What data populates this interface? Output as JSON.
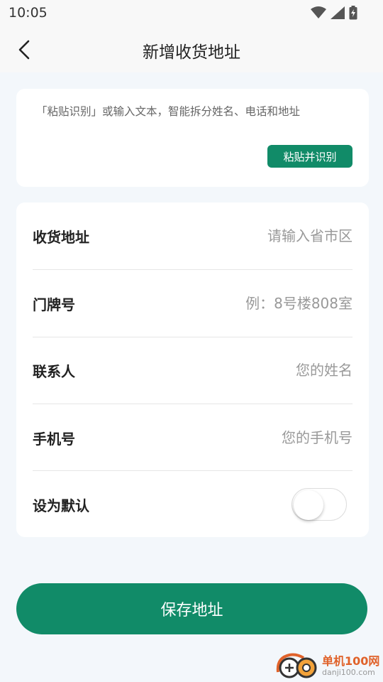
{
  "status_bar": {
    "time": "10:05"
  },
  "header": {
    "title": "新增收货地址"
  },
  "paste": {
    "hint": "「粘贴识别」或输入文本，智能拆分姓名、电话和地址",
    "button_label": "粘贴并识别"
  },
  "form": {
    "address": {
      "label": "收货地址",
      "placeholder": "请输入省市区"
    },
    "door": {
      "label": "门牌号",
      "placeholder": "例：8号楼808室"
    },
    "contact": {
      "label": "联系人",
      "placeholder": "您的姓名"
    },
    "phone": {
      "label": "手机号",
      "placeholder": "您的手机号"
    },
    "default": {
      "label": "设为默认",
      "checked": false
    }
  },
  "save_button": {
    "label": "保存地址"
  },
  "watermark": {
    "title": "单机100网",
    "url": "danji100.com"
  },
  "colors": {
    "accent": "#118b68",
    "background": "#f3f7fb"
  }
}
